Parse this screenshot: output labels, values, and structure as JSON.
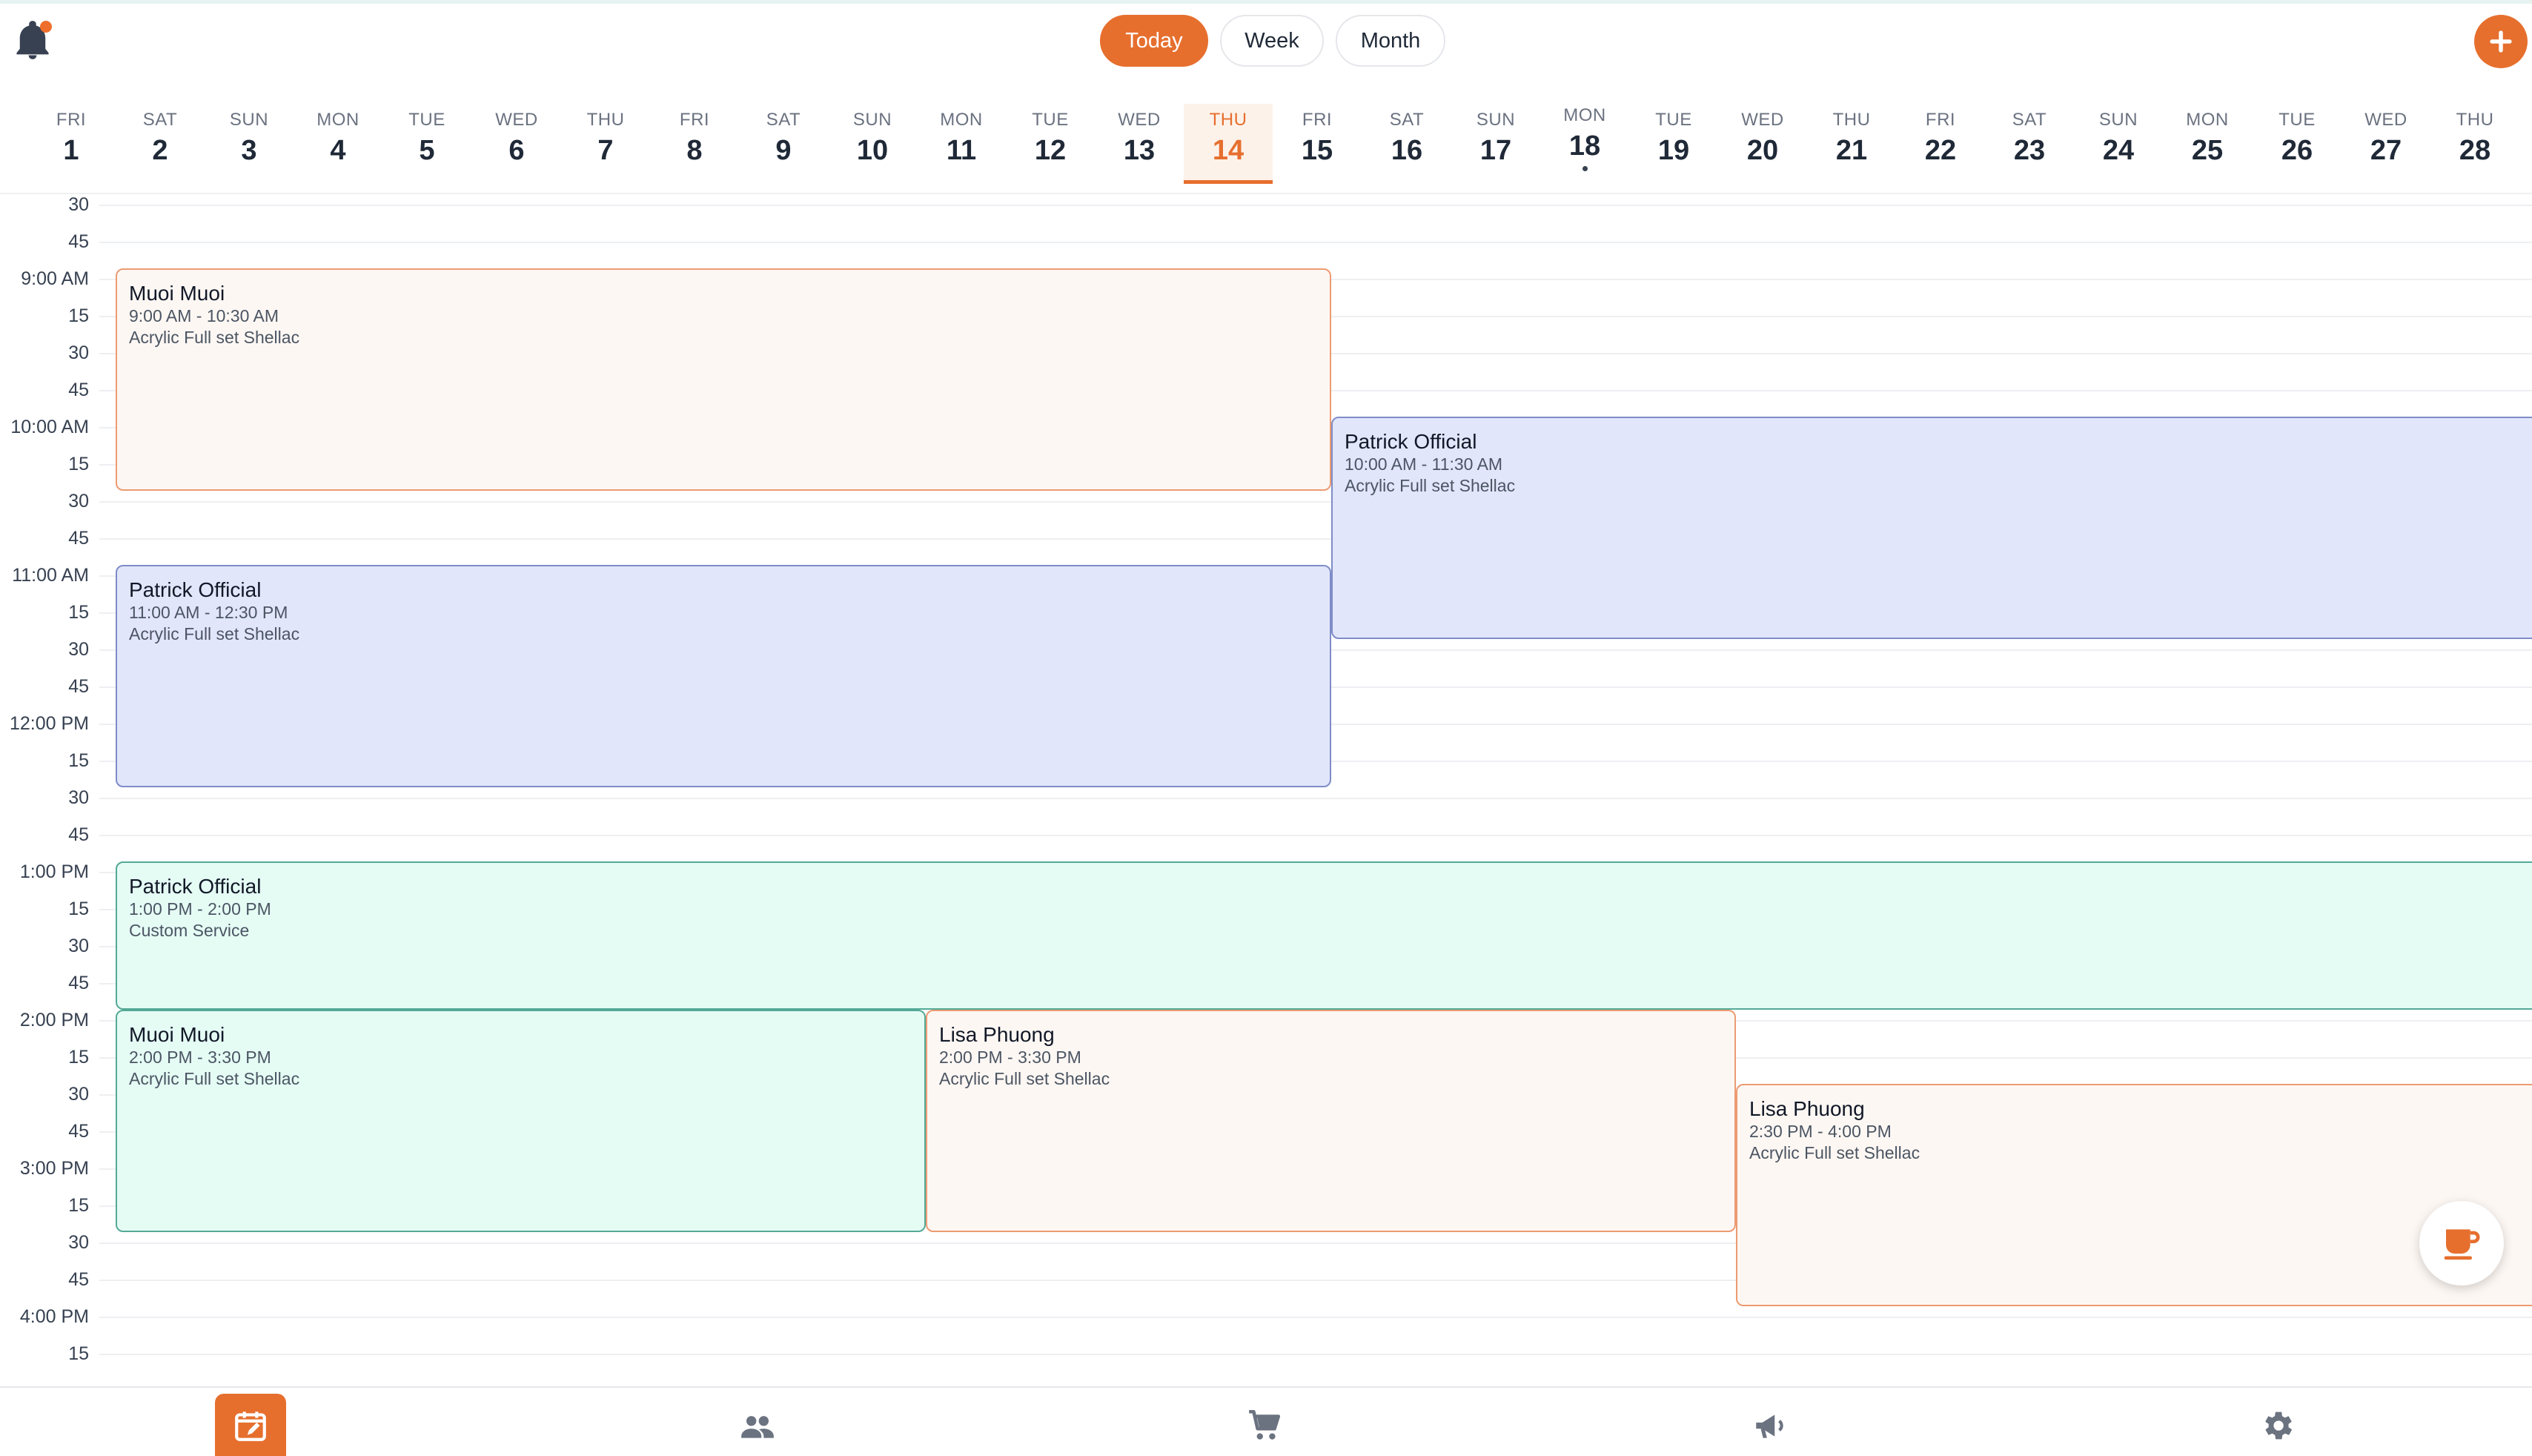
{
  "header": {
    "view_buttons": {
      "today": "Today",
      "week": "Week",
      "month": "Month"
    },
    "add_icon": "plus-icon",
    "bell_icon": "bell-icon",
    "colors": {
      "accent": "#e66f2e"
    }
  },
  "days": [
    {
      "dow": "FRI",
      "num": "1"
    },
    {
      "dow": "SAT",
      "num": "2"
    },
    {
      "dow": "SUN",
      "num": "3"
    },
    {
      "dow": "MON",
      "num": "4"
    },
    {
      "dow": "TUE",
      "num": "5"
    },
    {
      "dow": "WED",
      "num": "6"
    },
    {
      "dow": "THU",
      "num": "7"
    },
    {
      "dow": "FRI",
      "num": "8"
    },
    {
      "dow": "SAT",
      "num": "9"
    },
    {
      "dow": "SUN",
      "num": "10"
    },
    {
      "dow": "MON",
      "num": "11"
    },
    {
      "dow": "TUE",
      "num": "12"
    },
    {
      "dow": "WED",
      "num": "13"
    },
    {
      "dow": "THU",
      "num": "14"
    },
    {
      "dow": "FRI",
      "num": "15"
    },
    {
      "dow": "SAT",
      "num": "16"
    },
    {
      "dow": "SUN",
      "num": "17"
    },
    {
      "dow": "MON",
      "num": "18"
    },
    {
      "dow": "TUE",
      "num": "19"
    },
    {
      "dow": "WED",
      "num": "20"
    },
    {
      "dow": "THU",
      "num": "21"
    },
    {
      "dow": "FRI",
      "num": "22"
    },
    {
      "dow": "SAT",
      "num": "23"
    },
    {
      "dow": "SUN",
      "num": "24"
    },
    {
      "dow": "MON",
      "num": "25"
    },
    {
      "dow": "TUE",
      "num": "26"
    },
    {
      "dow": "WED",
      "num": "27"
    },
    {
      "dow": "THU",
      "num": "28"
    }
  ],
  "selected_day": "14",
  "today_dot_day": "18",
  "time_labels": [
    "30",
    "45",
    "9:00 AM",
    "15",
    "30",
    "45",
    "10:00 AM",
    "15",
    "30",
    "45",
    "11:00 AM",
    "15",
    "30",
    "45",
    "12:00 PM",
    "15",
    "30",
    "45",
    "1:00 PM",
    "15",
    "30",
    "45",
    "2:00 PM",
    "15",
    "30",
    "45",
    "3:00 PM",
    "15",
    "30",
    "45",
    "4:00 PM",
    "15"
  ],
  "events": [
    {
      "name": "Muoi Muoi",
      "time": "9:00 AM - 10:30 AM",
      "service": "Acrylic Full set Shellac",
      "color": "orange"
    },
    {
      "name": "Patrick Official",
      "time": "10:00 AM - 11:30 AM",
      "service": "Acrylic Full set Shellac",
      "color": "blue"
    },
    {
      "name": "Patrick Official",
      "time": "11:00 AM - 12:30 PM",
      "service": "Acrylic Full set Shellac",
      "color": "blue"
    },
    {
      "name": "Patrick Official",
      "time": "1:00 PM - 2:00 PM",
      "service": "Custom Service",
      "color": "green"
    },
    {
      "name": "Muoi Muoi",
      "time": "2:00 PM - 3:30 PM",
      "service": "Acrylic Full set Shellac",
      "color": "green"
    },
    {
      "name": "Lisa Phuong",
      "time": "2:00 PM - 3:30 PM",
      "service": "Acrylic Full set Shellac",
      "color": "orange"
    },
    {
      "name": "Lisa Phuong",
      "time": "2:30 PM - 4:00 PM",
      "service": "Acrylic Full set Shellac",
      "color": "orange"
    }
  ],
  "floating_button_icon": "coffee-cup-icon",
  "bottom_nav": [
    {
      "icon": "calendar-edit-icon",
      "active": true
    },
    {
      "icon": "people-icon",
      "active": false
    },
    {
      "icon": "cart-icon",
      "active": false
    },
    {
      "icon": "megaphone-icon",
      "active": false
    },
    {
      "icon": "gear-icon",
      "active": false
    }
  ]
}
